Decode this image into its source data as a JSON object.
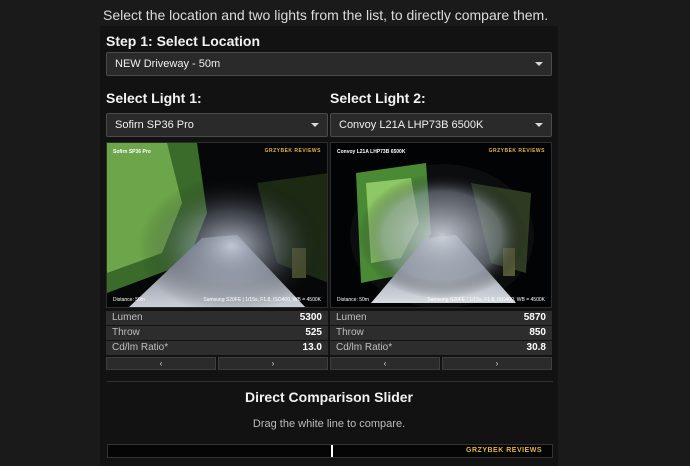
{
  "intro_text": "Select the location and two lights from the list, to directly compare them.",
  "step1": {
    "heading": "Step 1: Select Location",
    "selected": "NEW Driveway - 50m"
  },
  "light1": {
    "heading": "Select Light 1:",
    "selected": "Sofirn SP36 Pro",
    "photo": {
      "caption": "Sofirn SP36 Pro",
      "brand": "GRZYBEK REVIEWS",
      "distance": "Distance: 50m",
      "camera": "Samsung S20FE | 1/15s, F1.8, ISO400, WB = 4500K"
    },
    "stats": [
      {
        "key": "Lumen",
        "value": "5300"
      },
      {
        "key": "Throw",
        "value": "525"
      },
      {
        "key": "Cd/lm Ratio*",
        "value": "13.0"
      }
    ],
    "prev": "‹",
    "next": "›"
  },
  "light2": {
    "heading": "Select Light 2:",
    "selected": "Convoy L21A LHP73B 6500K",
    "photo": {
      "caption": "Convoy L21A LHP73B 6500K",
      "brand": "GRZYBEK REVIEWS",
      "distance": "Distance: 50m",
      "camera": "Samsung S20FE | 1/15s, F1.8, ISO400, WB = 4500K"
    },
    "stats": [
      {
        "key": "Lumen",
        "value": "5870"
      },
      {
        "key": "Throw",
        "value": "850"
      },
      {
        "key": "Cd/lm Ratio*",
        "value": "30.8"
      }
    ],
    "prev": "‹",
    "next": "›"
  },
  "comparison": {
    "title": "Direct Comparison Slider",
    "subtitle": "Drag the white line to compare.",
    "brand": "GRZYBEK REVIEWS"
  },
  "colors": {
    "background": "#1a1a1a",
    "panel": "#121212",
    "brand_gold": "#e2b34a"
  }
}
